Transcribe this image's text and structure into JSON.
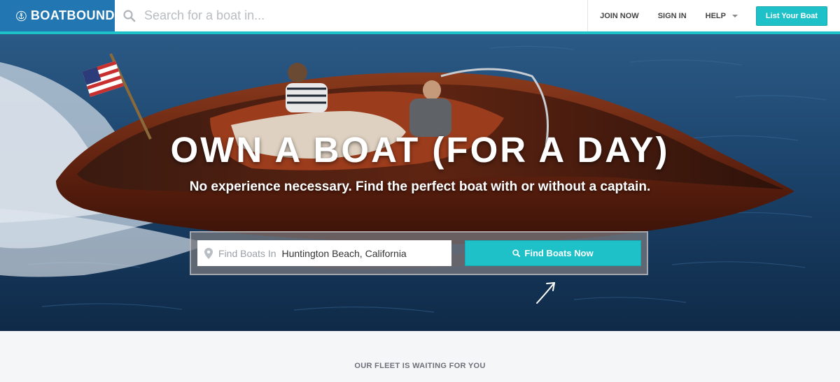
{
  "header": {
    "logo_text": "BOATBOUND",
    "logo_icon": "anchor-icon",
    "search_placeholder": "Search for a boat in...",
    "nav": {
      "join_now": "JOIN NOW",
      "sign_in": "SIGN IN",
      "help": "HELP"
    },
    "list_button": "List Your Boat"
  },
  "hero": {
    "headline": "OWN A BOAT (FOR A DAY)",
    "subheadline": "No experience necessary. Find the perfect boat with or without a captain.",
    "find": {
      "prefix": "Find Boats In",
      "value": "Huntington Beach, California",
      "button": "Find Boats Now"
    }
  },
  "fleet": {
    "title": "OUR FLEET IS WAITING FOR YOU"
  },
  "colors": {
    "brand_blue": "#2277b3",
    "accent_teal": "#1fc1c9",
    "water": "#16395d",
    "hull_wood": "#6b2a14"
  }
}
